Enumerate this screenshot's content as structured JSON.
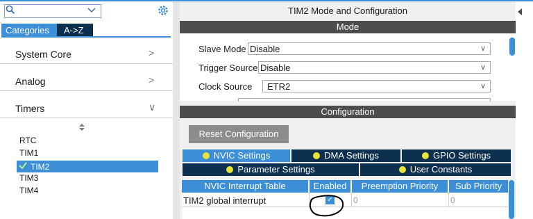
{
  "left_panel": {
    "search": {
      "value": "",
      "placeholder": ""
    },
    "tabs": [
      {
        "label": "Categories"
      },
      {
        "label": "A->Z"
      }
    ],
    "categories": [
      {
        "label": "System Core",
        "arrow": ">"
      },
      {
        "label": "Analog",
        "arrow": ">"
      },
      {
        "label": "Timers",
        "arrow": "∨"
      }
    ],
    "timers": [
      "RTC",
      "TIM1",
      "TIM2",
      "TIM3",
      "TIM4"
    ],
    "selected_timer": "TIM2"
  },
  "right_panel": {
    "title": "TIM2 Mode and Configuration",
    "mode_header": "Mode",
    "mode_fields": [
      {
        "label": "Slave Mode",
        "value": "Disable"
      },
      {
        "label": "Trigger Source",
        "value": "Disable"
      },
      {
        "label": "Clock Source",
        "value": "ETR2"
      }
    ],
    "config_header": "Configuration",
    "reset_button": "Reset Configuration",
    "settings_tabs_row1": [
      "NVIC Settings",
      "DMA Settings",
      "GPIO Settings"
    ],
    "settings_tabs_row2": [
      "Parameter Settings",
      "User Constants"
    ],
    "active_tab": "NVIC Settings",
    "table": {
      "headers": [
        "NVIC Interrupt Table",
        "Enabled",
        "Preemption Priority",
        "Sub Priority"
      ],
      "rows": [
        {
          "name": "TIM2 global interrupt",
          "enabled": true,
          "preemption": "0",
          "sub": "0"
        }
      ]
    }
  },
  "colors": {
    "accent": "#3c8fd6",
    "dark_tab": "#0e3050",
    "header": "#4d4d4d",
    "dot": "#e7e33a"
  }
}
